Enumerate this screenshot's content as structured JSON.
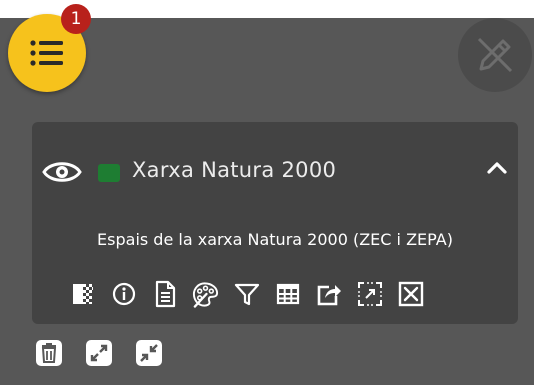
{
  "header": {
    "notification_count": "1"
  },
  "layer": {
    "title": "Xarxa Natura 2000",
    "description": "Espais de la xarxa Natura 2000 (ZEC i ZEPA)",
    "swatch_color": "#1e7d32"
  },
  "icons": {
    "menu": "list-icon",
    "edit": "pencil-icon",
    "visibility": "eye-icon",
    "collapse": "chevron-up-icon",
    "tools": [
      "opacity-icon",
      "info-icon",
      "document-icon",
      "palette-icon",
      "filter-icon",
      "table-icon",
      "share-icon",
      "zoom-extent-icon",
      "close-box-icon"
    ],
    "bottom": [
      "trash-icon",
      "expand-icon",
      "collapse-icon"
    ]
  },
  "colors": {
    "accent": "#f6c21c",
    "badge": "#b8211b",
    "panel": "#575757",
    "card": "#434343"
  }
}
